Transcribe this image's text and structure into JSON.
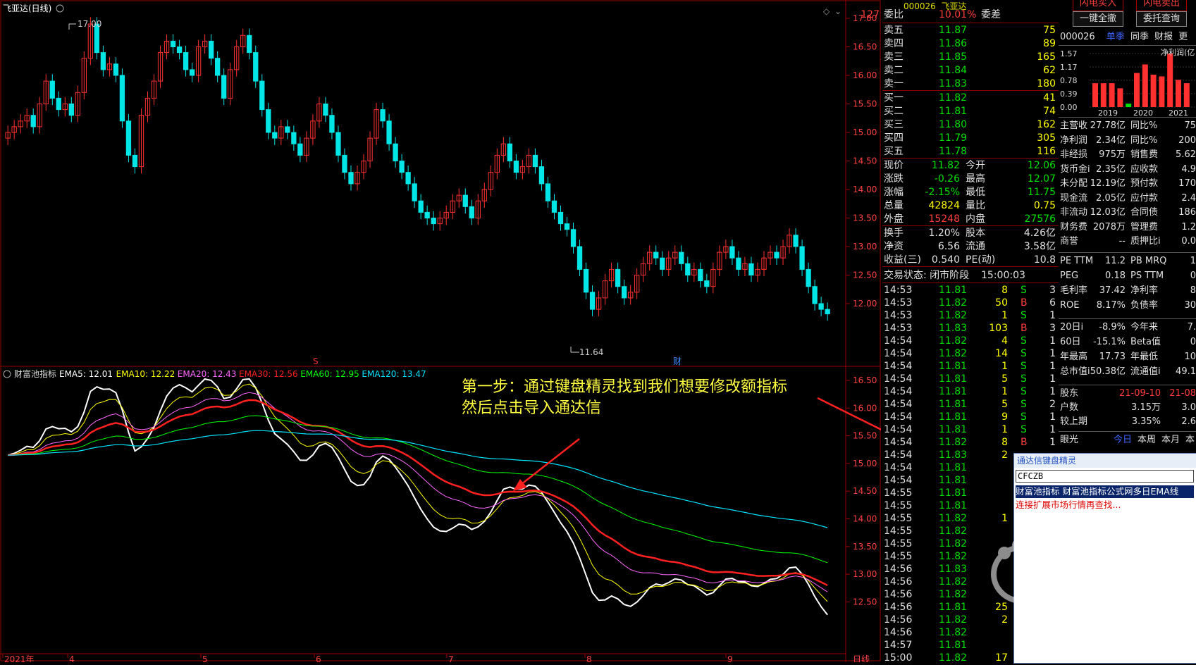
{
  "toolbar": {
    "code_fragment": "000026",
    "name_fragment": "飞亚达",
    "btn_flash_buy": "闪电买入",
    "btn_flash_sell": "闪电卖出",
    "btn_cancel_all": "一键全撤",
    "btn_order_query": "委托查询"
  },
  "kline": {
    "title": "飞亚达(日线)",
    "y_ticks": [
      "17.00",
      "16.50",
      "16.00",
      "15.50",
      "15.00",
      "14.50",
      "14.00",
      "13.50",
      "13.00",
      "12.50",
      "12.00"
    ],
    "high_label": "17.00",
    "low_label": "11.64",
    "marker_s": "S",
    "marker_cai": "财"
  },
  "indicator": {
    "name": "财富池指标",
    "legend": [
      {
        "text": "EMA5: 12.01",
        "color": "#ffffff"
      },
      {
        "text": "EMA10: 12.22",
        "color": "#ffff00"
      },
      {
        "text": "EMA20: 12.43",
        "color": "#ff66ff"
      },
      {
        "text": "EMA30: 12.56",
        "color": "#ff2020"
      },
      {
        "text": "EMA60: 12.95",
        "color": "#00ff00"
      },
      {
        "text": "EMA120: 13.47",
        "color": "#00e5ff"
      }
    ],
    "y_ticks": [
      "16.50",
      "16.00",
      "15.50",
      "15.00",
      "14.50",
      "14.00",
      "13.50",
      "13.00",
      "12.50"
    ]
  },
  "x_axis": {
    "labels": [
      "2021年",
      "4",
      "5",
      "6",
      "7",
      "8",
      "9"
    ],
    "period": "日线"
  },
  "annotation": {
    "line1": "第一步：通过键盘精灵找到我们想要修改额指标",
    "line2": "然后点击导入通达信"
  },
  "quote": {
    "webi_label": "委比",
    "webi_value": "10.01%",
    "wecha_label": "委差",
    "wecha_value": "127",
    "asks": [
      {
        "label": "卖五",
        "price": "11.87",
        "vol": "75"
      },
      {
        "label": "卖四",
        "price": "11.86",
        "vol": "89"
      },
      {
        "label": "卖三",
        "price": "11.85",
        "vol": "165"
      },
      {
        "label": "卖二",
        "price": "11.84",
        "vol": "62"
      },
      {
        "label": "卖一",
        "price": "11.83",
        "vol": "180"
      }
    ],
    "bids": [
      {
        "label": "买一",
        "price": "11.82",
        "vol": "41"
      },
      {
        "label": "买二",
        "price": "11.81",
        "vol": "74"
      },
      {
        "label": "买三",
        "price": "11.80",
        "vol": "162"
      },
      {
        "label": "买四",
        "price": "11.79",
        "vol": "305"
      },
      {
        "label": "买五",
        "price": "11.78",
        "vol": "116"
      }
    ],
    "stats": [
      {
        "l1": "现价",
        "v1": "11.82",
        "c1": "green",
        "l2": "今开",
        "v2": "12.06",
        "c2": "green"
      },
      {
        "l1": "涨跌",
        "v1": "-0.26",
        "c1": "green",
        "l2": "最高",
        "v2": "12.07",
        "c2": "green"
      },
      {
        "l1": "涨幅",
        "v1": "-2.15%",
        "c1": "green",
        "l2": "最低",
        "v2": "11.75",
        "c2": "green"
      },
      {
        "l1": "总量",
        "v1": "42824",
        "c1": "yellow",
        "l2": "量比",
        "v2": "0.75",
        "c2": "yellow"
      },
      {
        "l1": "外盘",
        "v1": "15248",
        "c1": "red",
        "l2": "内盘",
        "v2": "27576",
        "c2": "green"
      }
    ],
    "stats2": [
      {
        "l1": "换手",
        "v1": "1.20%",
        "l2": "股本",
        "v2": "4.26亿"
      },
      {
        "l1": "净资",
        "v1": "6.56",
        "l2": "流通",
        "v2": "3.58亿"
      },
      {
        "l1": "收益(三)",
        "v1": "0.540",
        "l2": "PE(动)",
        "v2": "10.8"
      }
    ],
    "status_label": "交易状态: 闭市阶段",
    "status_time": "15:00:03",
    "ticks": [
      {
        "t": "14:53",
        "p": "11.81",
        "v": "8",
        "d": "S",
        "n": "3"
      },
      {
        "t": "14:53",
        "p": "11.82",
        "v": "50",
        "d": "B",
        "n": "6"
      },
      {
        "t": "14:53",
        "p": "11.82",
        "v": "1",
        "d": "S",
        "n": "1"
      },
      {
        "t": "14:53",
        "p": "11.83",
        "v": "103",
        "d": "B",
        "n": "3"
      },
      {
        "t": "14:54",
        "p": "11.82",
        "v": "4",
        "d": "S",
        "n": "1"
      },
      {
        "t": "14:54",
        "p": "11.82",
        "v": "14",
        "d": "S",
        "n": "1"
      },
      {
        "t": "14:54",
        "p": "11.81",
        "v": "1",
        "d": "S",
        "n": "1"
      },
      {
        "t": "14:54",
        "p": "11.81",
        "v": "5",
        "d": "S",
        "n": "1"
      },
      {
        "t": "14:54",
        "p": "11.81",
        "v": "1",
        "d": "S",
        "n": "1"
      },
      {
        "t": "14:54",
        "p": "11.81",
        "v": "5",
        "d": "S",
        "n": "2"
      },
      {
        "t": "14:54",
        "p": "11.81",
        "v": "9",
        "d": "S",
        "n": "1"
      },
      {
        "t": "14:54",
        "p": "11.81",
        "v": "1",
        "d": "S",
        "n": "1"
      },
      {
        "t": "14:54",
        "p": "11.82",
        "v": "8",
        "d": "B",
        "n": "1"
      },
      {
        "t": "14:54",
        "p": "11.83",
        "v": "2",
        "d": "",
        "n": ""
      },
      {
        "t": "14:54",
        "p": "11.81",
        "v": "",
        "d": "",
        "n": ""
      },
      {
        "t": "14:54",
        "p": "11.81",
        "v": "",
        "d": "",
        "n": ""
      },
      {
        "t": "14:55",
        "p": "11.81",
        "v": "",
        "d": "",
        "n": ""
      },
      {
        "t": "14:55",
        "p": "11.81",
        "v": "",
        "d": "",
        "n": ""
      },
      {
        "t": "14:55",
        "p": "11.82",
        "v": "1",
        "d": "",
        "n": ""
      },
      {
        "t": "14:55",
        "p": "11.82",
        "v": "",
        "d": "",
        "n": ""
      },
      {
        "t": "14:55",
        "p": "11.82",
        "v": "",
        "d": "",
        "n": ""
      },
      {
        "t": "14:55",
        "p": "11.82",
        "v": "",
        "d": "",
        "n": ""
      },
      {
        "t": "14:56",
        "p": "11.83",
        "v": "",
        "d": "",
        "n": ""
      },
      {
        "t": "14:56",
        "p": "11.82",
        "v": "",
        "d": "",
        "n": ""
      },
      {
        "t": "14:56",
        "p": "11.82",
        "v": "",
        "d": "",
        "n": ""
      },
      {
        "t": "14:56",
        "p": "11.81",
        "v": "25",
        "d": "",
        "n": ""
      },
      {
        "t": "14:56",
        "p": "11.82",
        "v": "2",
        "d": "",
        "n": ""
      },
      {
        "t": "14:56",
        "p": "11.82",
        "v": "",
        "d": "",
        "n": ""
      },
      {
        "t": "14:57",
        "p": "11.81",
        "v": "",
        "d": "",
        "n": ""
      },
      {
        "t": "15:00",
        "p": "11.82",
        "v": "17",
        "d": "",
        "n": ""
      }
    ]
  },
  "finance": {
    "code": "000026",
    "tab_single": "单季",
    "tab_yoy": "同季",
    "tab_fin": "财报",
    "tab_more": "更",
    "bar_title": "净利润(亿",
    "bar_yticks": [
      "1.57",
      "1.17",
      "0.78",
      "0.39",
      "0.00"
    ],
    "bar_years": [
      "2019",
      "2020",
      "2021"
    ],
    "rows": [
      {
        "l1": "主营收",
        "v1": "27.78亿",
        "l2": "同比%",
        "v2": "75"
      },
      {
        "l1": "净利润",
        "v1": "2.34亿",
        "l2": "同比%",
        "v2": "200"
      },
      {
        "l1": "非经损",
        "v1": "975万",
        "l2": "销售费",
        "v2": "5.62"
      },
      {
        "l1": "货币金i",
        "v1": "2.35亿",
        "l2": "应收款",
        "v2": "4.9"
      },
      {
        "l1": "未分配",
        "v1": "12.19亿",
        "l2": "预付款",
        "v2": "170"
      },
      {
        "l1": "现金流",
        "v1": "2.05亿",
        "l2": "应付款",
        "v2": "2.4"
      },
      {
        "l1": "非流动",
        "v1": "12.03亿",
        "l2": "合同债",
        "v2": "186"
      },
      {
        "l1": "财务费",
        "v1": "2078万",
        "l2": "管理费",
        "v2": "1.2"
      },
      {
        "l1": "商誉",
        "v1": "--",
        "l2": "质押比i",
        "v2": "0.0"
      }
    ],
    "rows2": [
      {
        "l1": "PE TTM",
        "v1": "11.2",
        "l2": "PB MRQ",
        "v2": "1"
      },
      {
        "l1": "PEG",
        "v1": "0.18",
        "l2": "PS TTM",
        "v2": "0"
      },
      {
        "l1": "毛利率",
        "v1": "37.42",
        "l2": "净利率",
        "v2": "8"
      },
      {
        "l1": "ROE",
        "v1": "8.17%",
        "l2": "负债率",
        "v2": "30"
      }
    ],
    "rows3": [
      {
        "l1": "20日i",
        "v1": "-8.9%",
        "l2": "今年来",
        "v2": "7."
      },
      {
        "l1": "60日",
        "v1": "-15.1%",
        "l2": "Beta值",
        "v2": "0"
      },
      {
        "l1": "年最高",
        "v1": "17.73",
        "l2": "年最低",
        "v2": "10"
      },
      {
        "l1": "总市值i",
        "v1": "50.38亿",
        "l2": "流通值i",
        "v2": "49.1"
      }
    ],
    "rows4": [
      {
        "l1": "股东",
        "v1": "21-09-10",
        "l2": "",
        "v2": "21-08"
      },
      {
        "l1": "户数",
        "v1": "3.15万",
        "l2": "",
        "v2": "3.0"
      },
      {
        "l1": "较上期",
        "v1": "3.35%",
        "l2": "",
        "v2": "2.6"
      }
    ],
    "eye_label": "眼光",
    "eye_today": "今日",
    "eye_week": "本周",
    "eye_month": "本月",
    "eye_more": "本"
  },
  "jingling": {
    "title": "通达信键盘精灵",
    "input_value": "CFCZB",
    "result1": "财富池指标 财富池指标公式网多日EMA线",
    "result2": "连接扩展市场行情再查找..."
  }
}
